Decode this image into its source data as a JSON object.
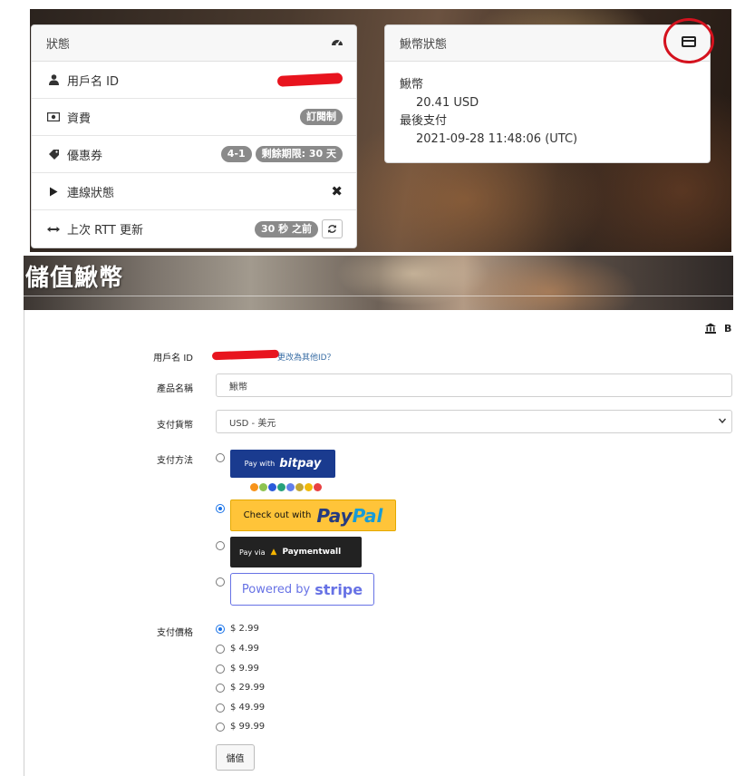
{
  "status_card": {
    "title": "狀態",
    "header_icon": "tachometer-icon",
    "rows": [
      {
        "icon": "user-icon",
        "label": "用戶名 ID",
        "value_redacted": true
      },
      {
        "icon": "money-icon",
        "label": "資費",
        "badges": [
          "訂閱制"
        ]
      },
      {
        "icon": "tag-icon",
        "label": "優惠券",
        "badges": [
          "4-1",
          "剩餘期限: 30 天"
        ]
      },
      {
        "icon": "play-icon",
        "label": "連線狀態",
        "value_icon": "close-icon"
      },
      {
        "icon": "arrows-h-icon",
        "label": "上次 RTT 更新",
        "badges": [
          "30 秒 之前"
        ],
        "action_icon": "refresh-icon"
      }
    ]
  },
  "currency_card": {
    "title": "鰍幣狀態",
    "header_icon": "credit-card-icon",
    "balance_label": "鰍幣",
    "balance_value": "20.41 USD",
    "last_payment_label": "最後支付",
    "last_payment_value": "2021-09-28 11:48:06 (UTC)"
  },
  "recharge": {
    "banner_title": "儲值鰍幣",
    "corner_icons": [
      "bank-icon",
      "bitcoin-icon"
    ],
    "corner_b": "B",
    "user_label": "用戶名 ID",
    "change_id_link": "更改為其他ID？",
    "product_label": "產品名稱",
    "product_value": "鰍幣",
    "currency_label": "支付貨幣",
    "currency_value": "USD - 美元",
    "method_label": "支付方法",
    "methods": [
      {
        "name": "bitpay",
        "prefix": "Pay with",
        "brand": "bitpay",
        "selected": false
      },
      {
        "name": "paypal",
        "prefix": "Check out with",
        "brand_a": "Pay",
        "brand_b": "Pal",
        "selected": true
      },
      {
        "name": "paymentwall",
        "prefix": "Pay via",
        "brand": "Paymentwall",
        "selected": false
      },
      {
        "name": "stripe",
        "prefix": "Powered by",
        "brand": "stripe",
        "selected": false
      }
    ],
    "bitpay_coin_colors": [
      "#f7931a",
      "#8dc351",
      "#2a5ada",
      "#26a17b",
      "#627eea",
      "#c2a633",
      "#f0b90b",
      "#e84142"
    ],
    "price_label": "支付價格",
    "prices": [
      "$ 2.99",
      "$ 4.99",
      "$ 9.99",
      "$ 29.99",
      "$ 49.99",
      "$ 99.99"
    ],
    "selected_price_index": 0,
    "submit_label": "儲值"
  }
}
